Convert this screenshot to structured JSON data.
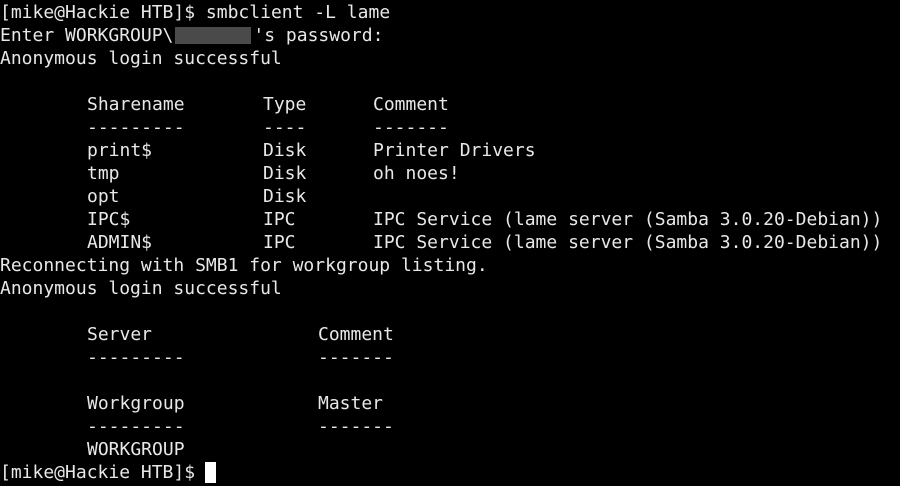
{
  "session": {
    "prompt": "[mike@Hackie HTB]$",
    "command": "smbclient -L lame",
    "password_prefix": "Enter WORKGROUP\\",
    "password_suffix": "'s password:",
    "login_msg_1": "Anonymous login successful",
    "reconnect_msg": "Reconnecting with SMB1 for workgroup listing.",
    "login_msg_2": "Anonymous login successful"
  },
  "shares": {
    "headers": [
      "Sharename",
      "Type",
      "Comment"
    ],
    "separators": [
      "---------",
      "----",
      "-------"
    ],
    "rows": [
      [
        "print$",
        "Disk",
        "Printer Drivers"
      ],
      [
        "tmp",
        "Disk",
        "oh noes!"
      ],
      [
        "opt",
        "Disk",
        ""
      ],
      [
        "IPC$",
        "IPC",
        "IPC Service (lame server (Samba 3.0.20-Debian))"
      ],
      [
        "ADMIN$",
        "IPC",
        "IPC Service (lame server (Samba 3.0.20-Debian))"
      ]
    ]
  },
  "servers": {
    "headers": [
      "Server",
      "Comment"
    ],
    "separators": [
      "---------",
      "-------"
    ]
  },
  "workgroups": {
    "headers": [
      "Workgroup",
      "Master"
    ],
    "separators": [
      "---------",
      "-------"
    ],
    "rows": [
      [
        "WORKGROUP",
        ""
      ]
    ]
  },
  "final_prompt": "[mike@Hackie HTB]$"
}
